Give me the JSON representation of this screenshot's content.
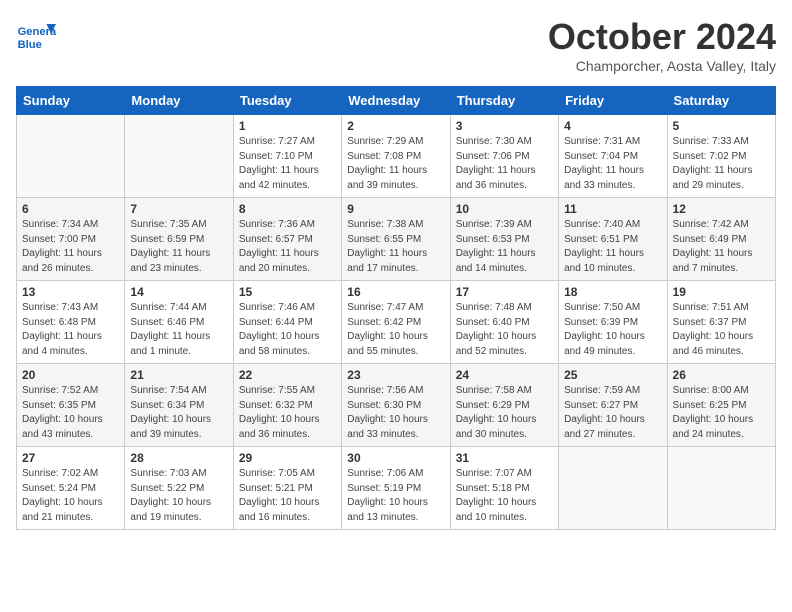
{
  "header": {
    "logo_line1": "General",
    "logo_line2": "Blue",
    "month": "October 2024",
    "location": "Champorcher, Aosta Valley, Italy"
  },
  "days_of_week": [
    "Sunday",
    "Monday",
    "Tuesday",
    "Wednesday",
    "Thursday",
    "Friday",
    "Saturday"
  ],
  "weeks": [
    [
      {
        "day": "",
        "info": ""
      },
      {
        "day": "",
        "info": ""
      },
      {
        "day": "1",
        "info": "Sunrise: 7:27 AM\nSunset: 7:10 PM\nDaylight: 11 hours and 42 minutes."
      },
      {
        "day": "2",
        "info": "Sunrise: 7:29 AM\nSunset: 7:08 PM\nDaylight: 11 hours and 39 minutes."
      },
      {
        "day": "3",
        "info": "Sunrise: 7:30 AM\nSunset: 7:06 PM\nDaylight: 11 hours and 36 minutes."
      },
      {
        "day": "4",
        "info": "Sunrise: 7:31 AM\nSunset: 7:04 PM\nDaylight: 11 hours and 33 minutes."
      },
      {
        "day": "5",
        "info": "Sunrise: 7:33 AM\nSunset: 7:02 PM\nDaylight: 11 hours and 29 minutes."
      }
    ],
    [
      {
        "day": "6",
        "info": "Sunrise: 7:34 AM\nSunset: 7:00 PM\nDaylight: 11 hours and 26 minutes."
      },
      {
        "day": "7",
        "info": "Sunrise: 7:35 AM\nSunset: 6:59 PM\nDaylight: 11 hours and 23 minutes."
      },
      {
        "day": "8",
        "info": "Sunrise: 7:36 AM\nSunset: 6:57 PM\nDaylight: 11 hours and 20 minutes."
      },
      {
        "day": "9",
        "info": "Sunrise: 7:38 AM\nSunset: 6:55 PM\nDaylight: 11 hours and 17 minutes."
      },
      {
        "day": "10",
        "info": "Sunrise: 7:39 AM\nSunset: 6:53 PM\nDaylight: 11 hours and 14 minutes."
      },
      {
        "day": "11",
        "info": "Sunrise: 7:40 AM\nSunset: 6:51 PM\nDaylight: 11 hours and 10 minutes."
      },
      {
        "day": "12",
        "info": "Sunrise: 7:42 AM\nSunset: 6:49 PM\nDaylight: 11 hours and 7 minutes."
      }
    ],
    [
      {
        "day": "13",
        "info": "Sunrise: 7:43 AM\nSunset: 6:48 PM\nDaylight: 11 hours and 4 minutes."
      },
      {
        "day": "14",
        "info": "Sunrise: 7:44 AM\nSunset: 6:46 PM\nDaylight: 11 hours and 1 minute."
      },
      {
        "day": "15",
        "info": "Sunrise: 7:46 AM\nSunset: 6:44 PM\nDaylight: 10 hours and 58 minutes."
      },
      {
        "day": "16",
        "info": "Sunrise: 7:47 AM\nSunset: 6:42 PM\nDaylight: 10 hours and 55 minutes."
      },
      {
        "day": "17",
        "info": "Sunrise: 7:48 AM\nSunset: 6:40 PM\nDaylight: 10 hours and 52 minutes."
      },
      {
        "day": "18",
        "info": "Sunrise: 7:50 AM\nSunset: 6:39 PM\nDaylight: 10 hours and 49 minutes."
      },
      {
        "day": "19",
        "info": "Sunrise: 7:51 AM\nSunset: 6:37 PM\nDaylight: 10 hours and 46 minutes."
      }
    ],
    [
      {
        "day": "20",
        "info": "Sunrise: 7:52 AM\nSunset: 6:35 PM\nDaylight: 10 hours and 43 minutes."
      },
      {
        "day": "21",
        "info": "Sunrise: 7:54 AM\nSunset: 6:34 PM\nDaylight: 10 hours and 39 minutes."
      },
      {
        "day": "22",
        "info": "Sunrise: 7:55 AM\nSunset: 6:32 PM\nDaylight: 10 hours and 36 minutes."
      },
      {
        "day": "23",
        "info": "Sunrise: 7:56 AM\nSunset: 6:30 PM\nDaylight: 10 hours and 33 minutes."
      },
      {
        "day": "24",
        "info": "Sunrise: 7:58 AM\nSunset: 6:29 PM\nDaylight: 10 hours and 30 minutes."
      },
      {
        "day": "25",
        "info": "Sunrise: 7:59 AM\nSunset: 6:27 PM\nDaylight: 10 hours and 27 minutes."
      },
      {
        "day": "26",
        "info": "Sunrise: 8:00 AM\nSunset: 6:25 PM\nDaylight: 10 hours and 24 minutes."
      }
    ],
    [
      {
        "day": "27",
        "info": "Sunrise: 7:02 AM\nSunset: 5:24 PM\nDaylight: 10 hours and 21 minutes."
      },
      {
        "day": "28",
        "info": "Sunrise: 7:03 AM\nSunset: 5:22 PM\nDaylight: 10 hours and 19 minutes."
      },
      {
        "day": "29",
        "info": "Sunrise: 7:05 AM\nSunset: 5:21 PM\nDaylight: 10 hours and 16 minutes."
      },
      {
        "day": "30",
        "info": "Sunrise: 7:06 AM\nSunset: 5:19 PM\nDaylight: 10 hours and 13 minutes."
      },
      {
        "day": "31",
        "info": "Sunrise: 7:07 AM\nSunset: 5:18 PM\nDaylight: 10 hours and 10 minutes."
      },
      {
        "day": "",
        "info": ""
      },
      {
        "day": "",
        "info": ""
      }
    ]
  ]
}
